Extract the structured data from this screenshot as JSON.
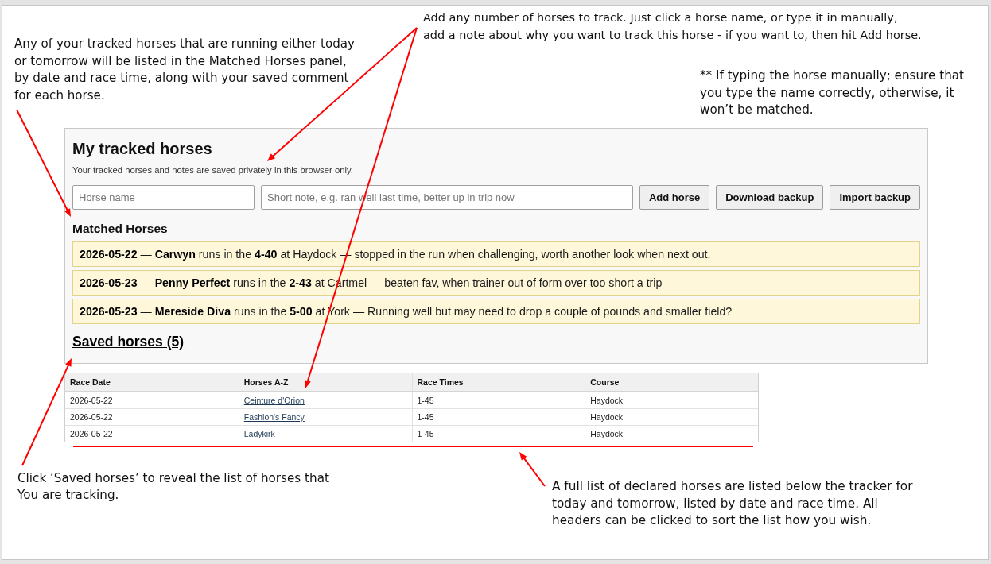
{
  "annotations": [
    {
      "text": "Add any number of horses to track. Just click a horse name, or type it in manually,\nadd a note about why you want to track this horse - if you want to, then hit Add horse."
    },
    {
      "text": "Any of your tracked horses that are running either today\nor tomorrow will be listed in the Matched Horses panel,\nby date and race time, along with your saved comment\nfor each horse."
    },
    {
      "text": "** If typing the horse manually; ensure that\nyou type the name correctly, otherwise, it\nwon’t be matched."
    },
    {
      "text": "Click ‘Saved horses’ to reveal the list of horses that\nYou are tracking."
    },
    {
      "text": "A full list of declared horses are listed below the tracker for\ntoday and tomorrow, listed by date and race time. All\nheaders can be clicked to sort the list how you wish."
    }
  ],
  "tracker": {
    "title": "My tracked horses",
    "subtitle": "Your tracked horses and notes are saved privately in this browser only.",
    "horse_input": {
      "placeholder": "Horse name"
    },
    "note_input": {
      "placeholder": "Short note, e.g. ran well last time, better up in trip now"
    },
    "buttons": [
      "Add horse",
      "Download backup",
      "Import backup"
    ],
    "matched_heading": "Matched Horses",
    "matched": [
      {
        "text": "**2026-05-22** — **Carwyn** runs in the **4-40** at Haydock — stopped in the run when challenging, worth another look when next out."
      },
      {
        "text": "**2026-05-23** — **Penny Perfect** runs in the **2-43** at Cartmel — beaten fav, when trainer out of form over too short a trip"
      },
      {
        "text": "**2026-05-23** — **Mereside Diva** runs in the **5-00** at York — Running well but may need to drop a couple of pounds and smaller field?"
      }
    ],
    "saved_link": "Saved horses (5)"
  },
  "table": {
    "columns": [
      {
        "label": "Race Date",
        "kind": "text"
      },
      {
        "label": "Horses A-Z",
        "kind": "link"
      },
      {
        "label": "Race Times",
        "kind": "text"
      },
      {
        "label": "Course",
        "kind": "text"
      }
    ],
    "rows": [
      [
        "2026-05-22",
        "Ceinture d'Orion",
        "1-45",
        "Haydock"
      ],
      [
        "2026-05-22",
        "Fashion's Fancy",
        "1-45",
        "Haydock"
      ],
      [
        "2026-05-22",
        "Ladykirk",
        "1-45",
        "Haydock"
      ]
    ]
  }
}
